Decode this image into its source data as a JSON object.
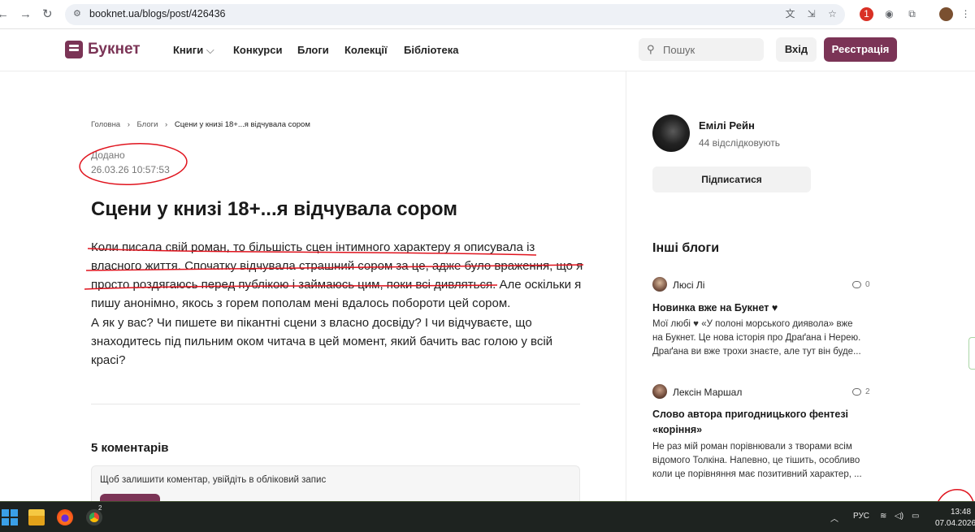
{
  "browser": {
    "url": "booknet.ua/blogs/post/426436",
    "back_icon": "back-arrow-icon",
    "forward_icon": "forward-arrow-icon",
    "reload_icon": "reload-icon",
    "badge_count": "1"
  },
  "header": {
    "logo_text": "Букнет",
    "nav": {
      "books": "Книги",
      "contests": "Конкурси",
      "blogs": "Блоги",
      "collections": "Колекції",
      "library": "Бібліотека"
    },
    "search_placeholder": "Пошук",
    "login_label": "Вхід",
    "register_label": "Реєстрація",
    "brand_color": "#7b3456"
  },
  "breadcrumb": {
    "home": "Головна",
    "blogs": "Блоги",
    "current": "Сцени у книзі 18+...я відчувала сором"
  },
  "article": {
    "added_label": "Додано",
    "added_date": "26.03.26 10:57:53",
    "title": "Сцени у книзі 18+...я відчувала сором",
    "paragraph1": "Коли писала свій роман, то більшість сцен інтимного характеру я описувала із власного життя. Спочатку відчувала страшний сором за це, адже було враження, що я просто роздягаюсь перед публікою і займаюсь цим, поки всі дивляться. Але оскільки я пишу анонімно, якось з горем пополам мені вдалось побороти цей сором.",
    "paragraph2": "А як у вас? Чи пишете ви пікантні сцени з власно досвіду? І чи відчуваєте, що знаходитесь під пильним оком читача в цей момент, який бачить вас голою у всій красі?"
  },
  "comments": {
    "title": "5 коментарів",
    "login_hint": "Щоб залишити коментар, увійдіть в обліковий запис"
  },
  "sidebar": {
    "author_name": "Емілі Рейн",
    "author_followers": "44  відслідковують",
    "follow_label": "Підписатися",
    "other_blogs_title": "Інші блоги",
    "blogs": [
      {
        "author": "Люсі Лі",
        "count": "0",
        "title": "Новинка вже на Букнет ♥",
        "excerpt": "Мої любі ♥ «У полоні морського диявола» вже на Букнет. Це нова історія про Драґана і Нерею. Драґана ви вже трохи знаєте, але тут він буде..."
      },
      {
        "author": "Лексін Маршал",
        "count": "2",
        "title": "Слово автора пригодницького фентезі «коріння»",
        "excerpt": "Не раз мій роман порівнювали з творами всім відомого Толкіна. Напевно, це тішить, особливо коли це порівняння має позитивний характер, ..."
      }
    ]
  },
  "taskbar": {
    "language": "РУС",
    "time": "13:48",
    "date": "07.04.2026",
    "chrome_badge": "2"
  },
  "annotation_color": "#e0141e"
}
